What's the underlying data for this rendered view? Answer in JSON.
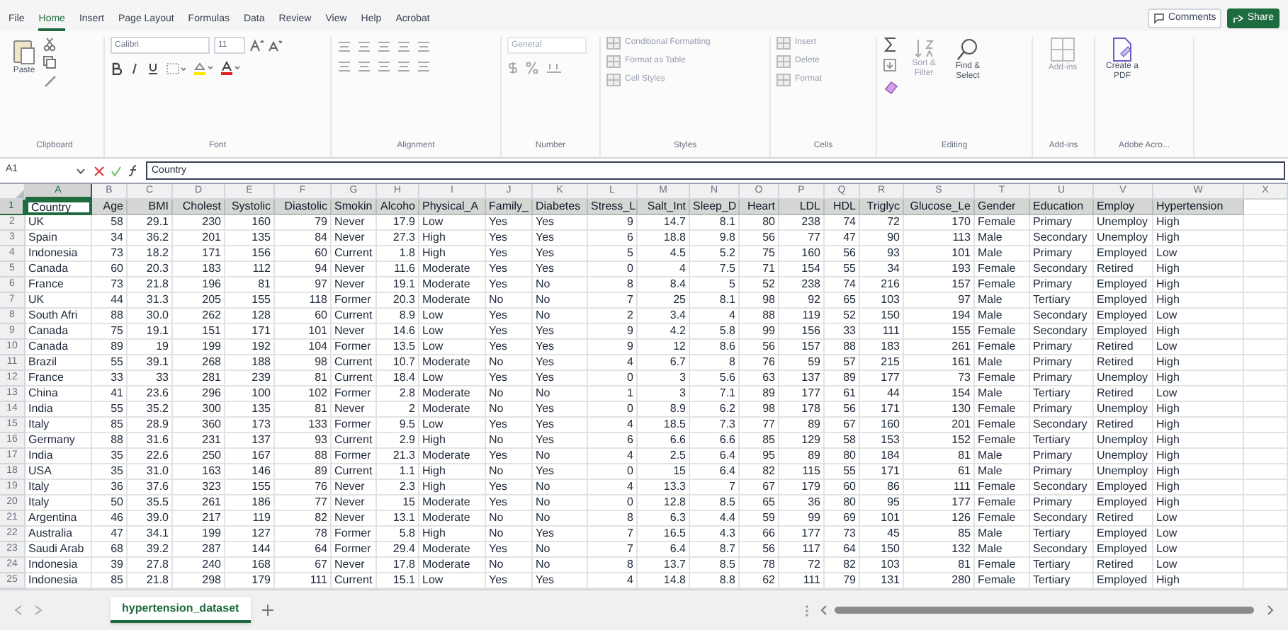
{
  "menu_tabs": [
    {
      "label": "File",
      "selected": false
    },
    {
      "label": "Home",
      "selected": true
    },
    {
      "label": "Insert",
      "selected": false
    },
    {
      "label": "Page Layout",
      "selected": false
    },
    {
      "label": "Formulas",
      "selected": false
    },
    {
      "label": "Data",
      "selected": false
    },
    {
      "label": "Review",
      "selected": false
    },
    {
      "label": "View",
      "selected": false
    },
    {
      "label": "Help",
      "selected": false
    },
    {
      "label": "Acrobat",
      "selected": false
    }
  ],
  "top_buttons": {
    "comments": "Comments",
    "share": "Share"
  },
  "ribbon": [
    {
      "kind": "clipboard",
      "label": "Clipboard",
      "texts": [
        "Paste"
      ]
    },
    {
      "kind": "font",
      "label": "Font",
      "texts": [
        "Calibri",
        "11"
      ]
    },
    {
      "kind": "alignment",
      "label": "Alignment"
    },
    {
      "kind": "number",
      "label": "Number",
      "texts": [
        "General"
      ]
    },
    {
      "kind": "styles",
      "label": "Styles",
      "texts": [
        "Conditional Formatting",
        "Format as Table",
        "Cell Styles"
      ]
    },
    {
      "kind": "cells",
      "label": "Cells",
      "texts": [
        "Insert",
        "Delete",
        "Format"
      ]
    },
    {
      "kind": "editing",
      "label": "Editing",
      "texts": [
        "Sort & Filter",
        "Find & Select"
      ]
    },
    {
      "kind": "addins",
      "label": "Add-ins",
      "texts": [
        "Add-ins"
      ]
    },
    {
      "kind": "pdf",
      "label": "Adobe Acro...",
      "texts": [
        "Create a PDF"
      ]
    }
  ],
  "formula_bar": {
    "name_box": "A1",
    "value": "Country"
  },
  "columns": [
    {
      "letter": "A",
      "header": "Country",
      "kind": "text",
      "selected": true
    },
    {
      "letter": "B",
      "header": "Age",
      "kind": "number",
      "selected": false
    },
    {
      "letter": "C",
      "header": "BMI",
      "kind": "number",
      "selected": false
    },
    {
      "letter": "D",
      "header": "Cholest",
      "kind": "number",
      "selected": false
    },
    {
      "letter": "E",
      "header": "Systolic",
      "kind": "number",
      "selected": false
    },
    {
      "letter": "F",
      "header": "Diastolic",
      "kind": "number",
      "selected": false
    },
    {
      "letter": "G",
      "header": "Smokin",
      "kind": "text",
      "selected": false
    },
    {
      "letter": "H",
      "header": "Alcoho",
      "kind": "number",
      "selected": false
    },
    {
      "letter": "I",
      "header": "Physical_A",
      "kind": "text",
      "selected": false
    },
    {
      "letter": "J",
      "header": "Family_",
      "kind": "text",
      "selected": false
    },
    {
      "letter": "K",
      "header": "Diabetes",
      "kind": "text",
      "selected": false
    },
    {
      "letter": "L",
      "header": "Stress_L",
      "kind": "number",
      "selected": false
    },
    {
      "letter": "M",
      "header": "Salt_Int",
      "kind": "number",
      "selected": false
    },
    {
      "letter": "N",
      "header": "Sleep_D",
      "kind": "number",
      "selected": false
    },
    {
      "letter": "O",
      "header": "Heart",
      "kind": "number",
      "selected": false
    },
    {
      "letter": "P",
      "header": "LDL",
      "kind": "number",
      "selected": false
    },
    {
      "letter": "Q",
      "header": "HDL",
      "kind": "number",
      "selected": false
    },
    {
      "letter": "R",
      "header": "Triglyc",
      "kind": "number",
      "selected": false
    },
    {
      "letter": "S",
      "header": "Glucose_Le",
      "kind": "number",
      "selected": false
    },
    {
      "letter": "T",
      "header": "Gender",
      "kind": "text",
      "selected": false
    },
    {
      "letter": "U",
      "header": "Education",
      "kind": "text",
      "selected": false
    },
    {
      "letter": "V",
      "header": "Employ",
      "kind": "text",
      "selected": false
    },
    {
      "letter": "W",
      "header": "Hypertension",
      "kind": "text",
      "selected": false
    }
  ],
  "extra_column_letters": [
    "X"
  ],
  "header_row_number": "1",
  "rows": [
    {
      "number": "2",
      "cells": [
        "UK",
        "58",
        "29.1",
        "230",
        "160",
        "79",
        "Never",
        "17.9",
        "Low",
        "Yes",
        "Yes",
        "9",
        "14.7",
        "8.1",
        "80",
        "238",
        "74",
        "72",
        "170",
        "Female",
        "Primary",
        "Unemploy",
        "High"
      ]
    },
    {
      "number": "3",
      "cells": [
        "Spain",
        "34",
        "36.2",
        "201",
        "135",
        "84",
        "Never",
        "27.3",
        "High",
        "Yes",
        "Yes",
        "6",
        "18.8",
        "9.8",
        "56",
        "77",
        "47",
        "90",
        "113",
        "Male",
        "Secondary",
        "Unemploy",
        "High"
      ]
    },
    {
      "number": "4",
      "cells": [
        "Indonesia",
        "73",
        "18.2",
        "171",
        "156",
        "60",
        "Current",
        "1.8",
        "High",
        "Yes",
        "Yes",
        "5",
        "4.5",
        "5.2",
        "75",
        "160",
        "56",
        "93",
        "101",
        "Male",
        "Primary",
        "Employed",
        "Low"
      ]
    },
    {
      "number": "5",
      "cells": [
        "Canada",
        "60",
        "20.3",
        "183",
        "112",
        "94",
        "Never",
        "11.6",
        "Moderate",
        "Yes",
        "Yes",
        "0",
        "4",
        "7.5",
        "71",
        "154",
        "55",
        "34",
        "193",
        "Female",
        "Secondary",
        "Retired",
        "High"
      ]
    },
    {
      "number": "6",
      "cells": [
        "France",
        "73",
        "21.8",
        "196",
        "81",
        "97",
        "Never",
        "19.1",
        "Moderate",
        "Yes",
        "No",
        "8",
        "8.4",
        "5",
        "52",
        "238",
        "74",
        "216",
        "157",
        "Female",
        "Primary",
        "Employed",
        "High"
      ]
    },
    {
      "number": "7",
      "cells": [
        "UK",
        "44",
        "31.3",
        "205",
        "155",
        "118",
        "Former",
        "20.3",
        "Moderate",
        "No",
        "No",
        "7",
        "25",
        "8.1",
        "98",
        "92",
        "65",
        "103",
        "97",
        "Male",
        "Tertiary",
        "Employed",
        "High"
      ]
    },
    {
      "number": "8",
      "cells": [
        "South Afri",
        "88",
        "30.0",
        "262",
        "128",
        "60",
        "Current",
        "8.9",
        "Low",
        "Yes",
        "No",
        "2",
        "3.4",
        "4",
        "88",
        "119",
        "52",
        "150",
        "194",
        "Male",
        "Secondary",
        "Employed",
        "Low"
      ]
    },
    {
      "number": "9",
      "cells": [
        "Canada",
        "75",
        "19.1",
        "151",
        "171",
        "101",
        "Never",
        "14.6",
        "Low",
        "Yes",
        "Yes",
        "9",
        "4.2",
        "5.8",
        "99",
        "156",
        "33",
        "111",
        "155",
        "Female",
        "Secondary",
        "Employed",
        "High"
      ]
    },
    {
      "number": "10",
      "cells": [
        "Canada",
        "89",
        "19",
        "199",
        "192",
        "104",
        "Former",
        "13.5",
        "Low",
        "Yes",
        "Yes",
        "9",
        "12",
        "8.6",
        "56",
        "157",
        "88",
        "183",
        "261",
        "Female",
        "Primary",
        "Retired",
        "Low"
      ]
    },
    {
      "number": "11",
      "cells": [
        "Brazil",
        "55",
        "39.1",
        "268",
        "188",
        "98",
        "Current",
        "10.7",
        "Moderate",
        "No",
        "Yes",
        "4",
        "6.7",
        "8",
        "76",
        "59",
        "57",
        "215",
        "161",
        "Male",
        "Primary",
        "Retired",
        "High"
      ]
    },
    {
      "number": "12",
      "cells": [
        "France",
        "33",
        "33",
        "281",
        "239",
        "81",
        "Current",
        "18.4",
        "Low",
        "Yes",
        "Yes",
        "0",
        "3",
        "5.6",
        "63",
        "137",
        "89",
        "177",
        "73",
        "Female",
        "Primary",
        "Unemploy",
        "High"
      ]
    },
    {
      "number": "13",
      "cells": [
        "China",
        "41",
        "23.6",
        "296",
        "100",
        "102",
        "Former",
        "2.8",
        "Moderate",
        "No",
        "No",
        "1",
        "3",
        "7.1",
        "89",
        "177",
        "61",
        "44",
        "154",
        "Male",
        "Tertiary",
        "Retired",
        "Low"
      ]
    },
    {
      "number": "14",
      "cells": [
        "India",
        "55",
        "35.2",
        "300",
        "135",
        "81",
        "Never",
        "2",
        "Moderate",
        "No",
        "Yes",
        "0",
        "8.9",
        "6.2",
        "98",
        "178",
        "56",
        "171",
        "130",
        "Female",
        "Primary",
        "Unemploy",
        "High"
      ]
    },
    {
      "number": "15",
      "cells": [
        "Italy",
        "85",
        "28.9",
        "360",
        "173",
        "133",
        "Former",
        "9.5",
        "Low",
        "Yes",
        "Yes",
        "4",
        "18.5",
        "7.3",
        "77",
        "89",
        "67",
        "160",
        "201",
        "Female",
        "Secondary",
        "Retired",
        "High"
      ]
    },
    {
      "number": "16",
      "cells": [
        "Germany",
        "88",
        "31.6",
        "231",
        "137",
        "93",
        "Current",
        "2.9",
        "High",
        "No",
        "Yes",
        "6",
        "6.6",
        "6.6",
        "85",
        "129",
        "58",
        "153",
        "152",
        "Female",
        "Tertiary",
        "Unemploy",
        "High"
      ]
    },
    {
      "number": "17",
      "cells": [
        "India",
        "35",
        "22.6",
        "250",
        "167",
        "88",
        "Former",
        "21.3",
        "Moderate",
        "Yes",
        "No",
        "4",
        "2.5",
        "6.4",
        "95",
        "89",
        "80",
        "184",
        "81",
        "Male",
        "Primary",
        "Unemploy",
        "High"
      ]
    },
    {
      "number": "18",
      "cells": [
        "USA",
        "35",
        "31.0",
        "163",
        "146",
        "89",
        "Current",
        "1.1",
        "High",
        "No",
        "Yes",
        "0",
        "15",
        "6.4",
        "82",
        "115",
        "55",
        "171",
        "61",
        "Male",
        "Primary",
        "Unemploy",
        "High"
      ]
    },
    {
      "number": "19",
      "cells": [
        "Italy",
        "36",
        "37.6",
        "323",
        "155",
        "76",
        "Never",
        "2.3",
        "High",
        "Yes",
        "No",
        "4",
        "13.3",
        "7",
        "67",
        "179",
        "60",
        "86",
        "111",
        "Female",
        "Secondary",
        "Employed",
        "High"
      ]
    },
    {
      "number": "20",
      "cells": [
        "Italy",
        "50",
        "35.5",
        "261",
        "186",
        "77",
        "Never",
        "15",
        "Moderate",
        "Yes",
        "No",
        "0",
        "12.8",
        "8.5",
        "65",
        "36",
        "80",
        "95",
        "177",
        "Female",
        "Primary",
        "Employed",
        "High"
      ]
    },
    {
      "number": "21",
      "cells": [
        "Argentina",
        "46",
        "39.0",
        "217",
        "119",
        "82",
        "Never",
        "13.1",
        "Moderate",
        "No",
        "No",
        "8",
        "6.3",
        "4.4",
        "59",
        "99",
        "69",
        "101",
        "126",
        "Female",
        "Secondary",
        "Retired",
        "Low"
      ]
    },
    {
      "number": "22",
      "cells": [
        "Australia",
        "47",
        "34.1",
        "199",
        "127",
        "78",
        "Former",
        "5.8",
        "High",
        "No",
        "Yes",
        "7",
        "16.5",
        "4.3",
        "66",
        "177",
        "73",
        "45",
        "85",
        "Male",
        "Tertiary",
        "Employed",
        "Low"
      ]
    },
    {
      "number": "23",
      "cells": [
        "Saudi Arab",
        "68",
        "39.2",
        "287",
        "144",
        "64",
        "Former",
        "29.4",
        "Moderate",
        "Yes",
        "No",
        "7",
        "6.4",
        "8.7",
        "56",
        "117",
        "64",
        "150",
        "132",
        "Male",
        "Secondary",
        "Employed",
        "Low"
      ]
    },
    {
      "number": "24",
      "cells": [
        "Indonesia",
        "39",
        "27.8",
        "240",
        "168",
        "67",
        "Never",
        "17.8",
        "Moderate",
        "No",
        "No",
        "8",
        "13.7",
        "8.5",
        "78",
        "72",
        "82",
        "103",
        "81",
        "Female",
        "Tertiary",
        "Retired",
        "Low"
      ]
    },
    {
      "number": "25",
      "cells": [
        "Indonesia",
        "85",
        "21.8",
        "298",
        "179",
        "111",
        "Current",
        "15.1",
        "Low",
        "Yes",
        "Yes",
        "4",
        "14.8",
        "8.8",
        "62",
        "111",
        "79",
        "131",
        "280",
        "Female",
        "Tertiary",
        "Employed",
        "High"
      ]
    }
  ],
  "sheet_tabs": [
    {
      "label": "hypertension_dataset",
      "selected": true
    }
  ]
}
